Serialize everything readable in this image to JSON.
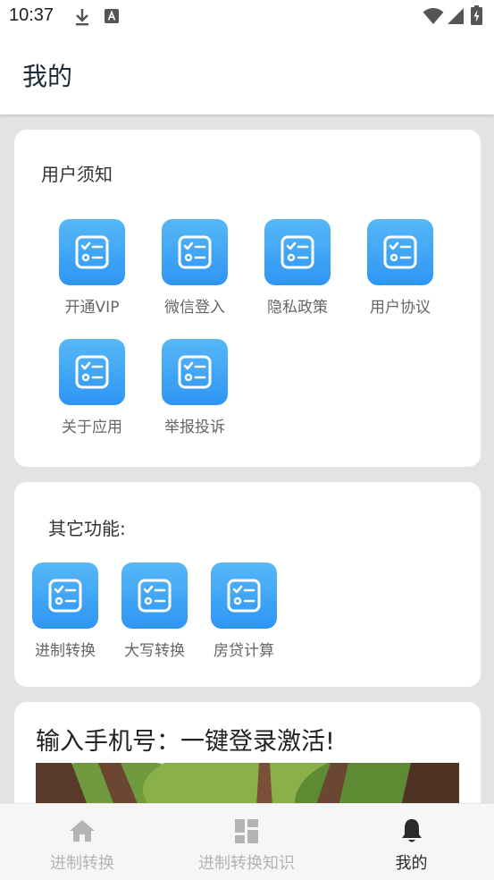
{
  "status_bar": {
    "time": "10:37",
    "icons": [
      "download-icon",
      "a-notification-icon",
      "wifi-icon",
      "signal-icon",
      "battery-icon"
    ]
  },
  "app_bar": {
    "title": "我的"
  },
  "user_notice": {
    "title": "用户须知",
    "items": [
      {
        "label": "开通VIP",
        "icon": "checklist-icon"
      },
      {
        "label": "微信登入",
        "icon": "checklist-icon"
      },
      {
        "label": "隐私政策",
        "icon": "checklist-icon"
      },
      {
        "label": "用户协议",
        "icon": "checklist-icon"
      },
      {
        "label": "关于应用",
        "icon": "checklist-icon"
      },
      {
        "label": "举报投诉",
        "icon": "checklist-icon"
      }
    ]
  },
  "other_functions": {
    "title": "其它功能:",
    "items": [
      {
        "label": "进制转换",
        "icon": "checklist-icon"
      },
      {
        "label": "大写转换",
        "icon": "checklist-icon"
      },
      {
        "label": "房贷计算",
        "icon": "checklist-icon"
      }
    ]
  },
  "promo": {
    "title": "输入手机号：一键登录激活!"
  },
  "bottom_nav": {
    "items": [
      {
        "label": "进制转换",
        "icon": "home-icon",
        "active": false
      },
      {
        "label": "进制转换知识",
        "icon": "dashboard-icon",
        "active": false
      },
      {
        "label": "我的",
        "icon": "bell-icon",
        "active": true
      }
    ]
  },
  "colors": {
    "accent_gradient_top": "#56b8f7",
    "accent_gradient_bottom": "#2f95f3",
    "nav_active": "#2a2a2a",
    "nav_inactive": "#b4b4b4",
    "page_background": "#e3e3e3"
  }
}
